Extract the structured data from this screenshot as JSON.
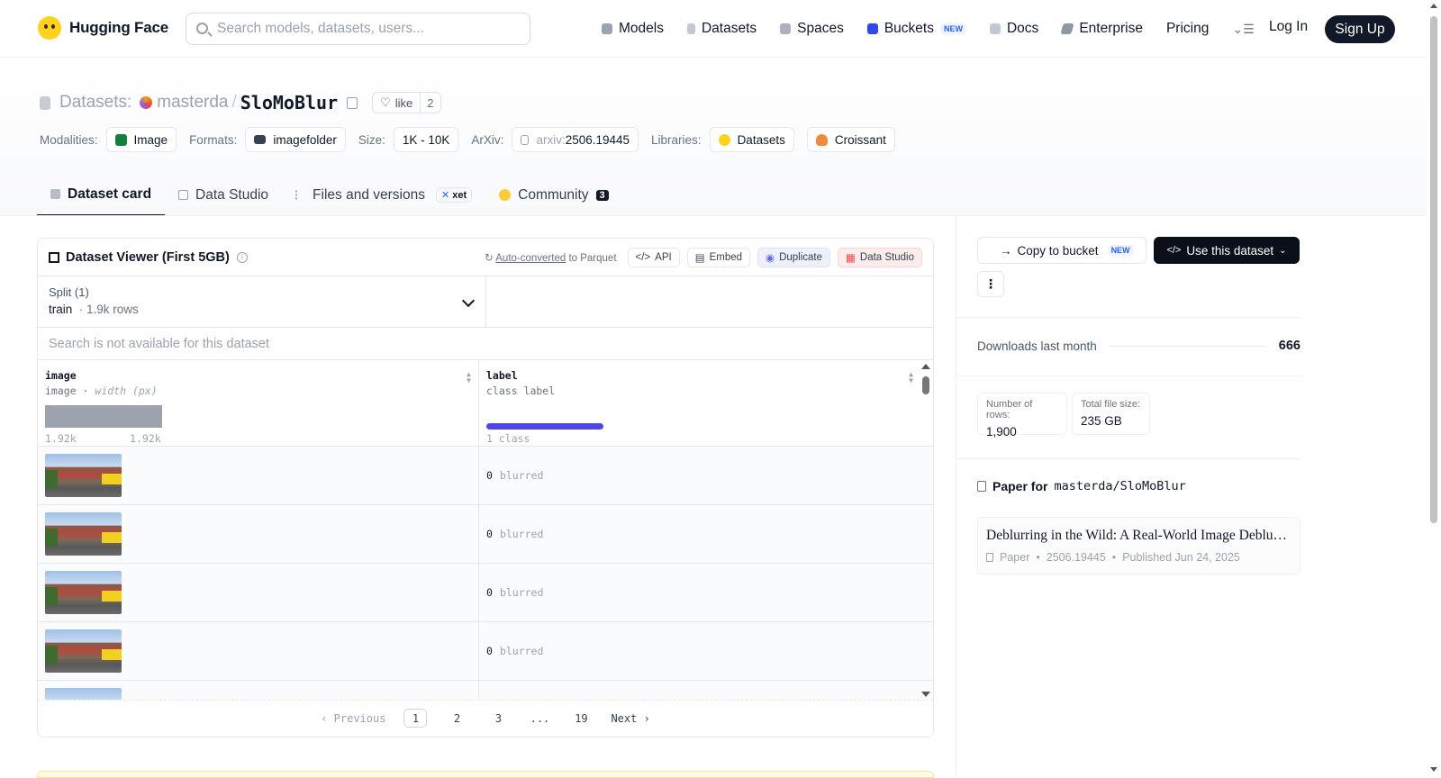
{
  "header": {
    "brand": "Hugging Face",
    "search_placeholder": "Search models, datasets, users...",
    "nav": [
      {
        "label": "Models",
        "icon": "models-icon"
      },
      {
        "label": "Datasets",
        "icon": "datasets-icon"
      },
      {
        "label": "Spaces",
        "icon": "spaces-icon"
      },
      {
        "label": "Buckets",
        "icon": "buckets-icon",
        "badge": "NEW"
      },
      {
        "label": "Docs",
        "icon": "docs-icon"
      },
      {
        "label": "Enterprise",
        "icon": "enterprise-icon"
      },
      {
        "label": "Pricing"
      }
    ],
    "login": "Log In",
    "signup": "Sign Up"
  },
  "repo": {
    "type_label": "Datasets:",
    "owner": "masterda",
    "name": "SloMoBlur",
    "like_label": "like",
    "like_count": "2"
  },
  "meta": {
    "modalities_key": "Modalities:",
    "modalities": "Image",
    "formats_key": "Formats:",
    "formats": "imagefolder",
    "size_key": "Size:",
    "size": "1K - 10K",
    "arxiv_key": "ArXiv:",
    "arxiv_prefix": "arxiv:",
    "arxiv": "2506.19445",
    "libraries_key": "Libraries:",
    "libraries": [
      "Datasets",
      "Croissant"
    ]
  },
  "tabs": [
    {
      "label": "Dataset card",
      "active": true
    },
    {
      "label": "Data Studio"
    },
    {
      "label": "Files and versions",
      "badge": "xet"
    },
    {
      "label": "Community",
      "count": "3"
    }
  ],
  "viewer": {
    "title": "Dataset Viewer (First 5GB)",
    "auto_converted": "Auto-converted",
    "to_parquet": " to Parquet",
    "actions": [
      "API",
      "Embed",
      "Duplicate",
      "Data Studio"
    ],
    "split_label": "Split (1)",
    "split_value": "train",
    "split_rows": "1.9k rows",
    "search_unavailable": "Search is not available for this dataset",
    "columns": [
      {
        "name": "image",
        "type": "image",
        "subtype": "width (px)",
        "hist_min": "1.92k",
        "hist_max": "1.92k"
      },
      {
        "name": "label",
        "type": "class label",
        "classes": "1 class"
      }
    ],
    "rows": [
      {
        "label_value": "0",
        "label_name": "blurred"
      },
      {
        "label_value": "0",
        "label_name": "blurred"
      },
      {
        "label_value": "0",
        "label_name": "blurred"
      },
      {
        "label_value": "0",
        "label_name": "blurred"
      }
    ],
    "pager": {
      "prev": "Previous",
      "pages": [
        "1",
        "2",
        "3",
        "...",
        "19"
      ],
      "next": "Next",
      "current": "1"
    }
  },
  "sidebar": {
    "copy_to_bucket": "Copy to bucket",
    "copy_badge": "NEW",
    "use_dataset": "Use this dataset",
    "downloads_label": "Downloads last month",
    "downloads": "666",
    "rows_label": "Number of rows:",
    "rows": "1,900",
    "size_label": "Total file size:",
    "size": "235 GB",
    "paper_for_label": "Paper for",
    "paper_for_repo": "masterda/SloMoBlur",
    "paper_title": "Deblurring in the Wild: A Real-World Image Deblurring Dataset",
    "paper_type": "Paper",
    "paper_id": "2506.19445",
    "paper_published": "Published Jun 24, 2025"
  }
}
